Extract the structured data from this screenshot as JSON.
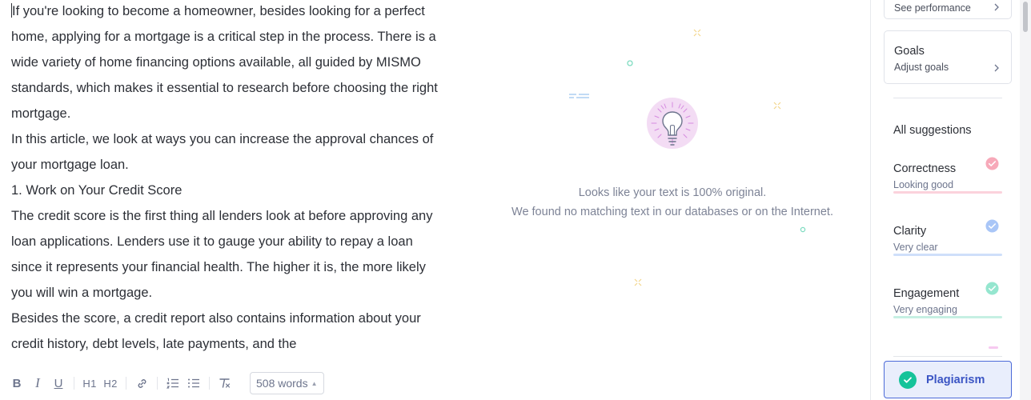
{
  "editor": {
    "paragraphs": [
      "If you're looking to become a homeowner, besides looking for a perfect home, applying for a mortgage is a critical step in the process. There is a wide variety of home financing options available, all guided by MISMO standards, which makes it essential to research before choosing the right mortgage.",
      "In this article, we look at ways you can increase the approval chances of your mortgage loan.",
      "1. Work on Your Credit Score",
      "The credit score is the first thing all lenders look at before approving any loan applications. Lenders use it to gauge your ability to repay a loan since it represents your financial health. The higher it is, the more likely you will win a mortgage.",
      "Besides the score, a credit report also contains information about your credit history, debt levels, late payments, and the"
    ]
  },
  "toolbar": {
    "bold": "B",
    "italic": "I",
    "underline": "U",
    "h1": "H1",
    "h2": "H2",
    "word_count": "508 words",
    "icons": [
      "link-icon",
      "ordered-list-icon",
      "bullet-list-icon",
      "clear-format-icon"
    ]
  },
  "plagiarism_result": {
    "line1": "Looks like your text is 100% original.",
    "line2": "We found no matching text in our databases or on the Internet.",
    "icon": "lightbulb-icon"
  },
  "sidebar": {
    "performance": {
      "label": "See performance"
    },
    "goals": {
      "title": "Goals",
      "sub": "Adjust goals"
    },
    "all_suggestions": "All suggestions",
    "categories": [
      {
        "title": "Correctness",
        "sub": "Looking good",
        "color": "#f2758f",
        "bar": "#fbd7df"
      },
      {
        "title": "Clarity",
        "sub": "Very clear",
        "color": "#6f9df5",
        "bar": "#d3e1fb"
      },
      {
        "title": "Engagement",
        "sub": "Very engaging",
        "color": "#35d1a8",
        "bar": "#c8f1e5"
      }
    ],
    "plagiarism_button": "Plagiarism"
  },
  "colors": {
    "accent": "#4c6ad8",
    "plagiarism_green": "#15c39a",
    "text": "#2c2f36",
    "muted": "#7d8396"
  }
}
